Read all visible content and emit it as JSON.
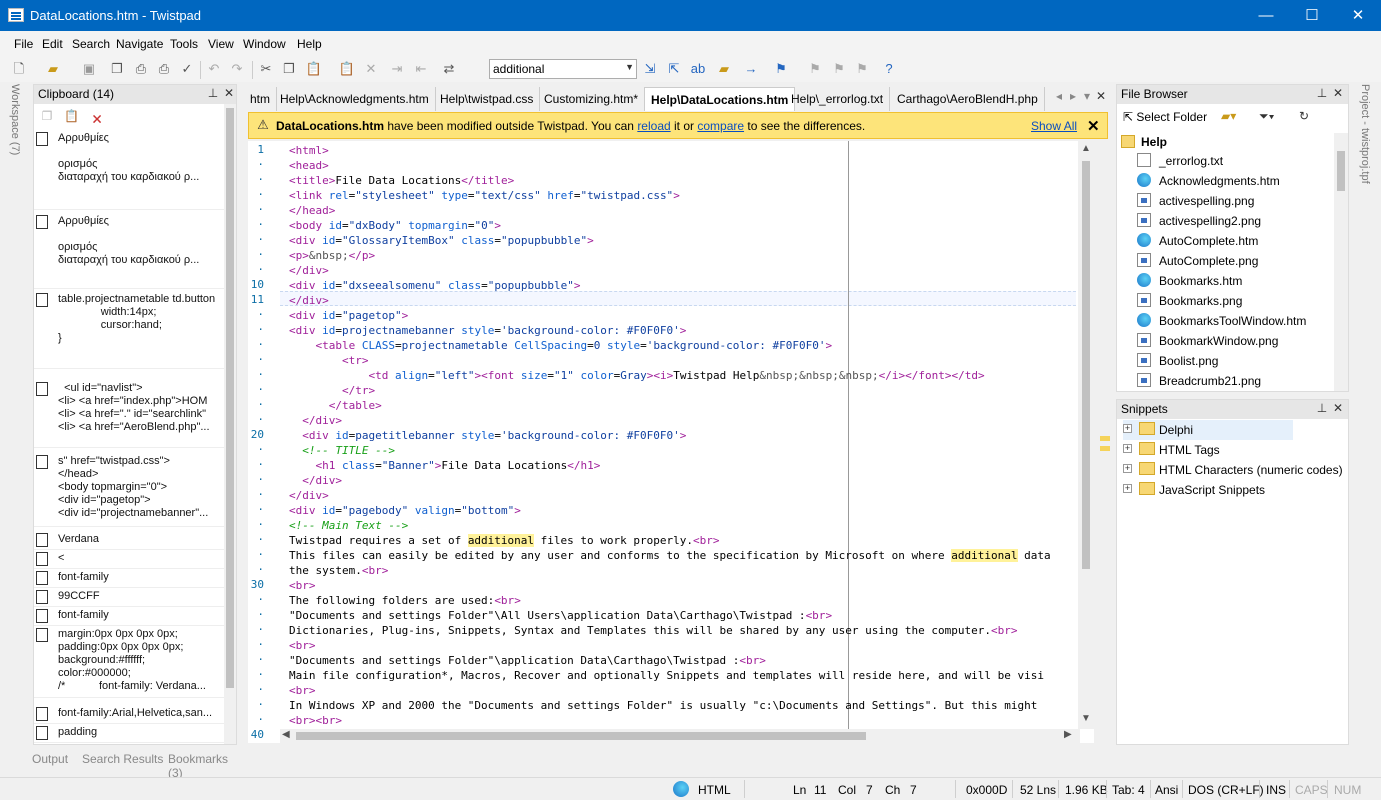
{
  "window": {
    "title": "DataLocations.htm - Twistpad",
    "minimize": "—",
    "maximize": "☐",
    "close": "✕"
  },
  "menu": [
    "File",
    "Edit",
    "Search",
    "Navigate",
    "Tools",
    "View",
    "Window",
    "Help"
  ],
  "toolbar": {
    "search_value": "additional"
  },
  "workspace_label": "Workspace (7)",
  "clipboard": {
    "title": "Clipboard (14)",
    "items": [
      "Αρρυθμίες\n\nορισμός\nδιαταραχή του καρδιακού ρ...",
      "Αρρυθμίες\n\nορισμός\nδιαταραχή του καρδιακού ρ...",
      "table.projectnametable td.button\n              width:14px;\n              cursor:hand;\n}",
      "  <ul id=\"navlist\">\n<li> <a href=\"index.php\">HOM\n<li> <a href=\".\" id=\"searchlink\"\n<li> <a href=\"AeroBlend.php\"...",
      "s\" href=\"twistpad.css\">\n</head>\n<body topmargin=\"0\">\n<div id=\"pagetop\">\n<div id=\"projectnamebanner\"...",
      "Verdana",
      "<",
      "font-family",
      "99CCFF",
      "font-family",
      "margin:0px 0px 0px 0px;\npadding:0px 0px 0px 0px;\nbackground:#ffffff;\ncolor:#000000;\n/*           font-family: Verdana...",
      "font-family:Arial,Helvetica,san...",
      "padding"
    ]
  },
  "bottom_tabs": [
    "Output",
    "Search Results",
    "Bookmarks (3)"
  ],
  "tabs": [
    "htm",
    "Help\\Acknowledgments.htm",
    "Help\\twistpad.css",
    "Customizing.htm*",
    "Help\\DataLocations.htm",
    "Help\\_errorlog.txt",
    "Carthago\\AeroBlendH.php"
  ],
  "infobar": {
    "file": "DataLocations.htm",
    "pre": " have been modified outside Twistpad. You can ",
    "reload": "reload",
    "mid": " it or ",
    "compare": "compare",
    "post": " to see the differences.",
    "show_all": "Show All"
  },
  "gutter": [
    "1",
    "·",
    "·",
    "·",
    "·",
    "·",
    "·",
    "·",
    "·",
    "10",
    "11",
    "·",
    "·",
    "·",
    "·",
    "·",
    "·",
    "·",
    "·",
    "20",
    "·",
    "·",
    "·",
    "·",
    "·",
    "·",
    "·",
    "·",
    "·",
    "30",
    "·",
    "·",
    "·",
    "·",
    "·",
    "·",
    "·",
    "·",
    "·",
    "40"
  ],
  "code": [
    "<html>",
    "<head>",
    "<title>File Data Locations</title>",
    "<link rel=\"stylesheet\" type=\"text/css\" href=\"twistpad.css\">",
    "</head>",
    "<body id=\"dxBody\" topmargin=\"0\">",
    "<div id=\"GlossaryItemBox\" class=\"popupbubble\">",
    "<p>&nbsp;</p>",
    "</div>",
    "<div id=\"dxseealsomenu\" class=\"popupbubble\">",
    "</div>",
    "<div id=\"pagetop\">",
    "<div id=projectnamebanner style='background-color: #F0F0F0'>",
    "    <table CLASS=projectnametable CellSpacing=0 style='background-color: #F0F0F0'>",
    "        <tr>",
    "            <td align=\"left\"><font size=\"1\" color=Gray><i>Twistpad Help&nbsp;&nbsp;&nbsp;</i></font></td>",
    "        </tr>",
    "      </table>",
    "  </div>",
    "  <div id=pagetitlebanner style='background-color: #F0F0F0'>",
    "  <!-- TITLE -->",
    "    <h1 class=\"Banner\">File Data Locations</h1>",
    "  </div>",
    "</div>",
    "<div id=\"pagebody\" valign=\"bottom\">",
    "<!-- Main Text -->",
    "Twistpad requires a set of additional files to work properly.<br>",
    "This files can easily be edited by any user and conforms to the specification by Microsoft on where additional data",
    "the system.<br>",
    "<br>",
    "The following folders are used:<br>",
    "\"Documents and settings Folder\"\\All Users\\application Data\\Carthago\\Twistpad :<br>",
    "Dictionaries, Plug-ins, Snippets, Syntax and Templates this will be shared by any user using the computer.<br>",
    "<br>",
    "\"Documents and settings Folder\"\\application Data\\Carthago\\Twistpad :<br>",
    "Main file configuration*, Macros, Recover and optionally Snippets and templates will reside here, and will be visi",
    "<br>",
    "In Windows XP and 2000 the \"Documents and settings Folder\" is usually \"c:\\Documents and Settings\". But this might",
    "<br><br>",
    ""
  ],
  "file_browser": {
    "title": "File Browser",
    "select_folder": "Select Folder",
    "folder": "Help",
    "files": [
      {
        "name": "_errorlog.txt",
        "icon": "text-file-icon"
      },
      {
        "name": "Acknowledgments.htm",
        "icon": "edge-browser-icon"
      },
      {
        "name": "activespelling.png",
        "icon": "image-file-icon"
      },
      {
        "name": "activespelling2.png",
        "icon": "image-file-icon"
      },
      {
        "name": "AutoComplete.htm",
        "icon": "edge-browser-icon"
      },
      {
        "name": "AutoComplete.png",
        "icon": "image-file-icon"
      },
      {
        "name": "Bookmarks.htm",
        "icon": "edge-browser-icon"
      },
      {
        "name": "Bookmarks.png",
        "icon": "image-file-icon"
      },
      {
        "name": "BookmarksToolWindow.htm",
        "icon": "edge-browser-icon"
      },
      {
        "name": "BookmarkWindow.png",
        "icon": "image-file-icon"
      },
      {
        "name": "Boolist.png",
        "icon": "image-file-icon"
      },
      {
        "name": "Breadcrumb21.png",
        "icon": "image-file-icon"
      }
    ]
  },
  "snippets": {
    "title": "Snippets",
    "items": [
      "Delphi",
      "HTML Tags",
      "HTML Characters (numeric codes)",
      "JavaScript Snippets"
    ]
  },
  "project_label": "Project - twistproj.tpf",
  "status": {
    "lang": "HTML",
    "ln_label": "Ln",
    "ln": "11",
    "col_label": "Col",
    "col": "7",
    "ch_label": "Ch",
    "ch": "7",
    "char": "0x000D",
    "lines": "52 Lns",
    "size": "1.96 KB",
    "tab": "Tab: 4",
    "enc": "Ansi",
    "eol": "DOS (CR+LF)",
    "ins": "INS",
    "caps": "CAPS",
    "num": "NUM"
  },
  "colors": {
    "titlebar": "#0067c0",
    "infobar": "#fde47a",
    "tag": "#a0209a",
    "attr": "#1060d0",
    "comment": "#18a018"
  }
}
